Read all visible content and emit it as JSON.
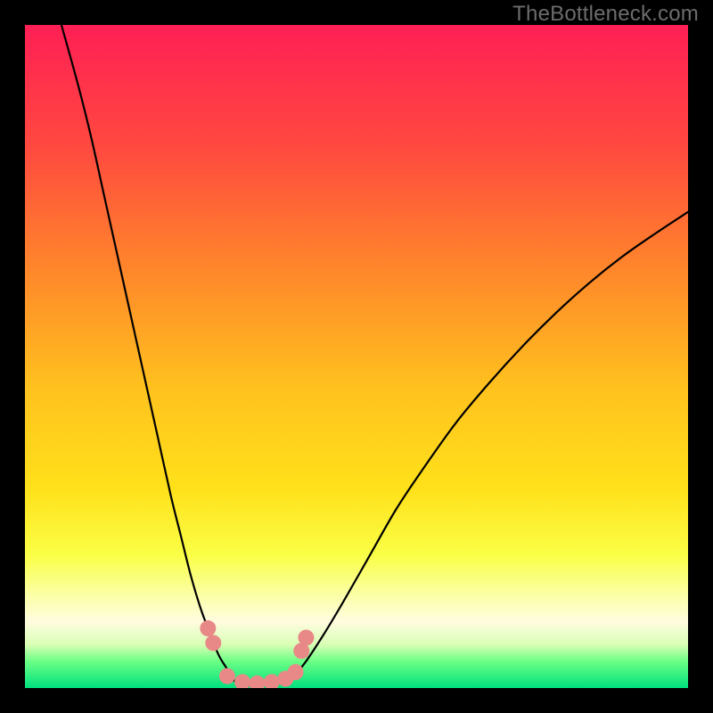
{
  "watermark": {
    "text": "TheBottleneck.com"
  },
  "chart_data": {
    "type": "line",
    "title": "",
    "xlabel": "",
    "ylabel": "",
    "xlim": [
      0,
      100
    ],
    "ylim": [
      0,
      100
    ],
    "grid": false,
    "legend": false,
    "gradient_colors": {
      "top": "#ff1f55",
      "upper_mid": "#ff7429",
      "mid": "#ffe11a",
      "lower_mid": "#f6ff7c",
      "band": "#fffce0",
      "green_top": "#6bff85",
      "green_bottom": "#00e07e"
    },
    "series": [
      {
        "name": "left_arm",
        "x": [
          5.5,
          8,
          10,
          12,
          14,
          16,
          18,
          20,
          22,
          23.5,
          25,
          26.5,
          28,
          29.2,
          30.4,
          31.5
        ],
        "y": [
          100,
          91,
          83,
          74,
          65,
          56,
          47,
          38,
          29,
          23,
          17,
          12,
          8,
          5,
          3,
          1.2
        ]
      },
      {
        "name": "valley_floor",
        "x": [
          31.5,
          32.5,
          34,
          35.5,
          37,
          38.5,
          40
        ],
        "y": [
          1.2,
          0.6,
          0.4,
          0.4,
          0.5,
          0.8,
          1.4
        ]
      },
      {
        "name": "right_arm",
        "x": [
          40,
          42,
          45,
          48,
          52,
          56,
          60,
          65,
          70,
          75,
          80,
          85,
          90,
          95,
          100
        ],
        "y": [
          1.4,
          3.5,
          8,
          13,
          20,
          27,
          33,
          40,
          46,
          51.5,
          56.5,
          61,
          65,
          68.5,
          71.8
        ]
      }
    ],
    "markers": [
      {
        "x": 27.6,
        "y": 9.0
      },
      {
        "x": 28.4,
        "y": 6.8
      },
      {
        "x": 30.5,
        "y": 1.8
      },
      {
        "x": 32.8,
        "y": 0.9
      },
      {
        "x": 35.0,
        "y": 0.7
      },
      {
        "x": 37.2,
        "y": 0.9
      },
      {
        "x": 39.3,
        "y": 1.4
      },
      {
        "x": 40.8,
        "y": 2.4
      },
      {
        "x": 41.7,
        "y": 5.6
      },
      {
        "x": 42.4,
        "y": 7.6
      }
    ],
    "marker_style": {
      "color": "#e98987",
      "radius_px": 9
    }
  }
}
